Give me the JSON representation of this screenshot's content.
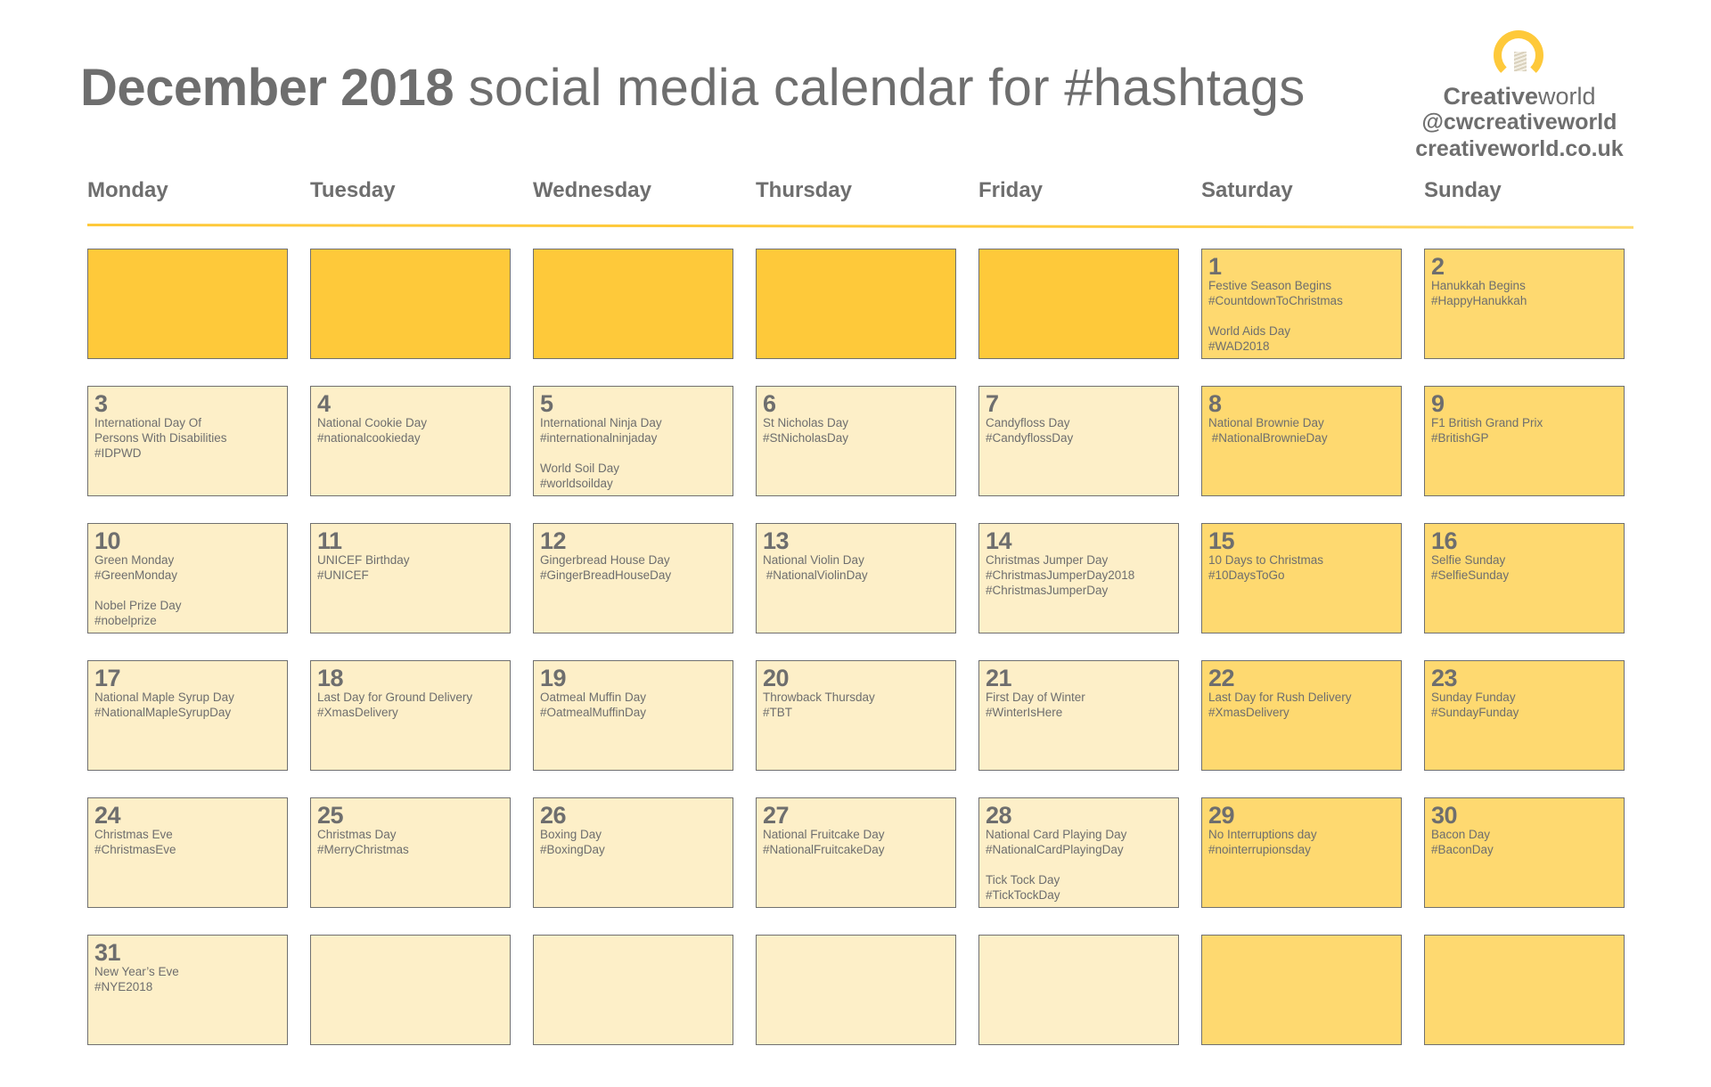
{
  "title": {
    "bold": "December 2018",
    "light": "social media calendar for #hashtags"
  },
  "brand": {
    "icon": "lightbulb-icon",
    "name_bold": "Creative",
    "name_light": "world",
    "handle": "@cwcreativeworld",
    "website": "creativeworld.co.uk"
  },
  "colors": {
    "accent": "#fec93a",
    "weekend": "#fed970",
    "weekday": "#fdefc8",
    "border": "#707070",
    "text": "#6e6e6e"
  },
  "weekdays": [
    "Monday",
    "Tuesday",
    "Wednesday",
    "Thursday",
    "Friday",
    "Saturday",
    "Sunday"
  ],
  "weeks": [
    [
      {
        "day": "",
        "style": "blank-strong",
        "events": []
      },
      {
        "day": "",
        "style": "blank-strong",
        "events": []
      },
      {
        "day": "",
        "style": "blank-strong",
        "events": []
      },
      {
        "day": "",
        "style": "blank-strong",
        "events": []
      },
      {
        "day": "",
        "style": "blank-strong",
        "events": []
      },
      {
        "day": "1",
        "style": "weekend",
        "events": [
          {
            "name": "Festive Season Begins",
            "tags": [
              "#CountdownToChristmas"
            ]
          },
          {
            "name": "World Aids Day",
            "tags": [
              "#WAD2018"
            ]
          }
        ]
      },
      {
        "day": "2",
        "style": "weekend",
        "events": [
          {
            "name": "Hanukkah Begins",
            "tags": [
              "#HappyHanukkah"
            ]
          }
        ]
      }
    ],
    [
      {
        "day": "3",
        "style": "weekday",
        "events": [
          {
            "name": "International Day Of\nPersons With Disabilities",
            "tags": [
              "#IDPWD"
            ]
          }
        ]
      },
      {
        "day": "4",
        "style": "weekday",
        "events": [
          {
            "name": "National Cookie Day",
            "tags": [
              "#nationalcookieday"
            ]
          }
        ]
      },
      {
        "day": "5",
        "style": "weekday",
        "events": [
          {
            "name": "International Ninja Day",
            "tags": [
              "#internationalninjaday"
            ]
          },
          {
            "name": "World Soil Day",
            "tags": [
              "#worldsoilday"
            ]
          }
        ]
      },
      {
        "day": "6",
        "style": "weekday",
        "events": [
          {
            "name": "St Nicholas Day",
            "tags": [
              "#StNicholasDay"
            ]
          }
        ]
      },
      {
        "day": "7",
        "style": "weekday",
        "events": [
          {
            "name": "Candyfloss Day",
            "tags": [
              "#CandyflossDay"
            ]
          }
        ]
      },
      {
        "day": "8",
        "style": "weekend",
        "events": [
          {
            "name": "National Brownie Day",
            "tags": [
              " #NationalBrownieDay"
            ]
          }
        ]
      },
      {
        "day": "9",
        "style": "weekend",
        "events": [
          {
            "name": "F1 British Grand Prix",
            "tags": [
              "#BritishGP"
            ]
          }
        ]
      }
    ],
    [
      {
        "day": "10",
        "style": "weekday",
        "events": [
          {
            "name": "Green Monday",
            "tags": [
              "#GreenMonday"
            ]
          },
          {
            "name": "Nobel Prize Day",
            "tags": [
              "#nobelprize"
            ]
          }
        ]
      },
      {
        "day": "11",
        "style": "weekday",
        "events": [
          {
            "name": "UNICEF Birthday",
            "tags": [
              "#UNICEF"
            ]
          }
        ]
      },
      {
        "day": "12",
        "style": "weekday",
        "events": [
          {
            "name": "Gingerbread House Day",
            "tags": [
              "#GingerBreadHouseDay"
            ]
          }
        ]
      },
      {
        "day": "13",
        "style": "weekday",
        "events": [
          {
            "name": "National Violin Day",
            "tags": [
              " #NationalViolinDay"
            ]
          }
        ]
      },
      {
        "day": "14",
        "style": "weekday",
        "events": [
          {
            "name": "Christmas Jumper Day",
            "tags": [
              "#ChristmasJumperDay2018",
              "#ChristmasJumperDay"
            ]
          }
        ]
      },
      {
        "day": "15",
        "style": "weekend",
        "events": [
          {
            "name": "10 Days to Christmas",
            "tags": [
              "#10DaysToGo"
            ]
          }
        ]
      },
      {
        "day": "16",
        "style": "weekend",
        "events": [
          {
            "name": "Selfie Sunday",
            "tags": [
              "#SelfieSunday"
            ]
          }
        ]
      }
    ],
    [
      {
        "day": "17",
        "style": "weekday",
        "events": [
          {
            "name": "National Maple Syrup Day",
            "tags": [
              "#NationalMapleSyrupDay"
            ]
          }
        ]
      },
      {
        "day": "18",
        "style": "weekday",
        "events": [
          {
            "name": "Last Day for Ground Delivery",
            "tags": [
              "#XmasDelivery"
            ]
          }
        ]
      },
      {
        "day": "19",
        "style": "weekday",
        "events": [
          {
            "name": "Oatmeal Muffin Day",
            "tags": [
              "#OatmealMuffinDay"
            ]
          }
        ]
      },
      {
        "day": "20",
        "style": "weekday",
        "events": [
          {
            "name": "Throwback Thursday",
            "tags": [
              "#TBT"
            ]
          }
        ]
      },
      {
        "day": "21",
        "style": "weekday",
        "events": [
          {
            "name": "First Day of Winter",
            "tags": [
              "#WinterIsHere"
            ]
          }
        ]
      },
      {
        "day": "22",
        "style": "weekend",
        "events": [
          {
            "name": "Last Day for Rush Delivery",
            "tags": [
              "#XmasDelivery"
            ]
          }
        ]
      },
      {
        "day": "23",
        "style": "weekend",
        "events": [
          {
            "name": "Sunday Funday",
            "tags": [
              "#SundayFunday"
            ]
          }
        ]
      }
    ],
    [
      {
        "day": "24",
        "style": "weekday",
        "events": [
          {
            "name": "Christmas Eve",
            "tags": [
              "#ChristmasEve"
            ]
          }
        ]
      },
      {
        "day": "25",
        "style": "weekday",
        "events": [
          {
            "name": "Christmas Day",
            "tags": [
              "#MerryChristmas"
            ]
          }
        ]
      },
      {
        "day": "26",
        "style": "weekday",
        "events": [
          {
            "name": "Boxing Day",
            "tags": [
              "#BoxingDay"
            ]
          }
        ]
      },
      {
        "day": "27",
        "style": "weekday",
        "events": [
          {
            "name": "National Fruitcake Day",
            "tags": [
              "#NationalFruitcakeDay"
            ]
          }
        ]
      },
      {
        "day": "28",
        "style": "weekday",
        "events": [
          {
            "name": "National Card Playing Day",
            "tags": [
              "#NationalCardPlayingDay"
            ]
          },
          {
            "name": "Tick Tock Day",
            "tags": [
              "#TickTockDay"
            ]
          }
        ]
      },
      {
        "day": "29",
        "style": "weekend",
        "events": [
          {
            "name": "No Interruptions day",
            "tags": [
              "#nointerrupionsday"
            ]
          }
        ]
      },
      {
        "day": "30",
        "style": "weekend",
        "events": [
          {
            "name": "Bacon Day",
            "tags": [
              "#BaconDay"
            ]
          }
        ]
      }
    ],
    [
      {
        "day": "31",
        "style": "weekday",
        "events": [
          {
            "name": "New Year’s Eve",
            "tags": [
              "#NYE2018"
            ]
          }
        ]
      },
      {
        "day": "",
        "style": "weekday",
        "events": []
      },
      {
        "day": "",
        "style": "weekday",
        "events": []
      },
      {
        "day": "",
        "style": "weekday",
        "events": []
      },
      {
        "day": "",
        "style": "weekday",
        "events": []
      },
      {
        "day": "",
        "style": "weekend",
        "events": []
      },
      {
        "day": "",
        "style": "weekend",
        "events": []
      }
    ]
  ]
}
